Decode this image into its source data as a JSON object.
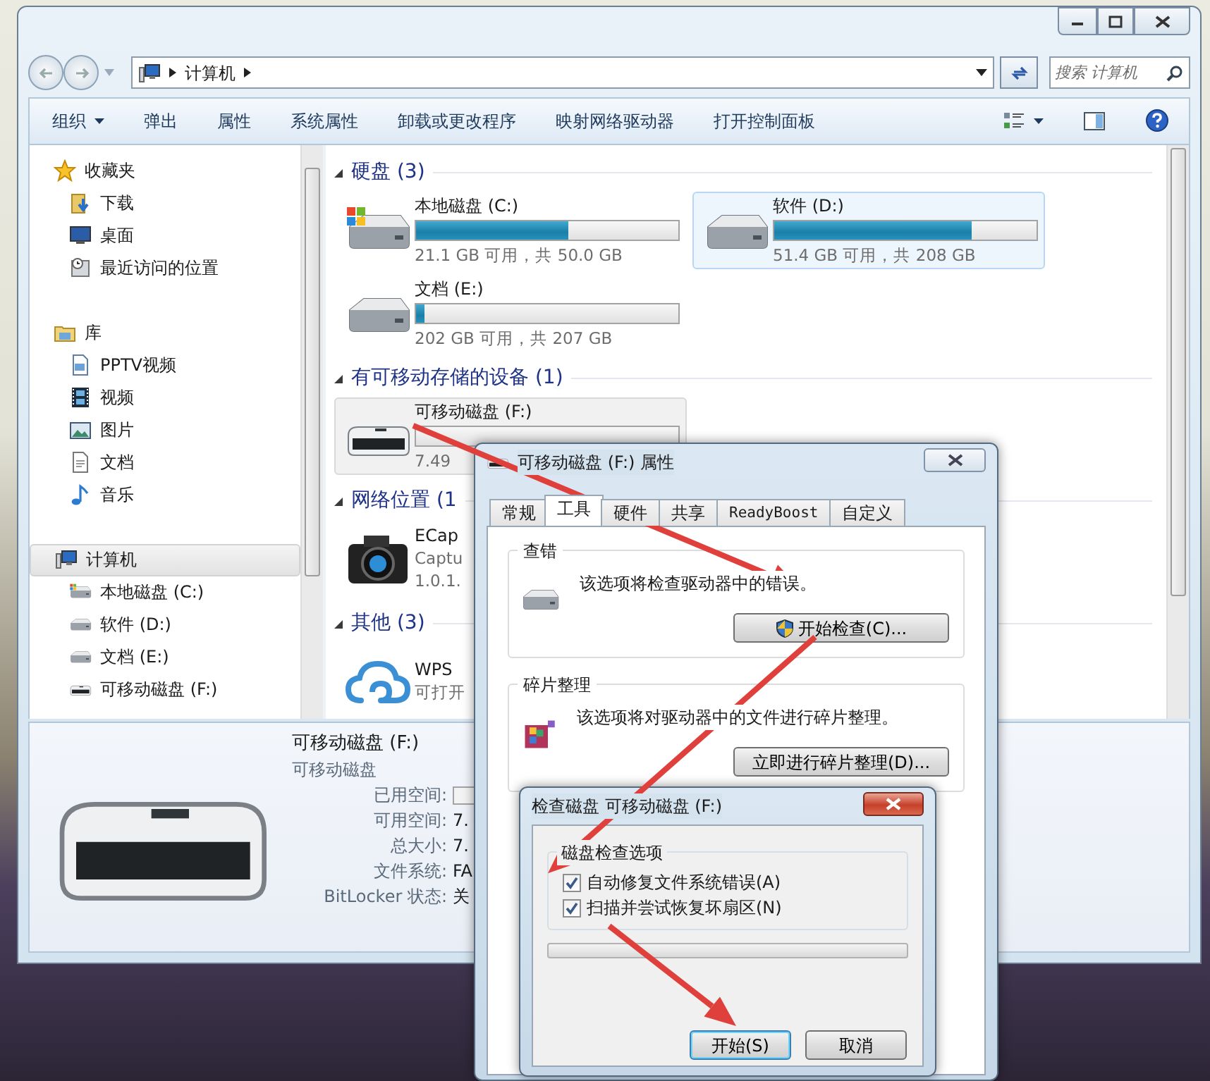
{
  "explorer": {
    "breadcrumb": [
      "计算机"
    ],
    "search_placeholder": "搜索 计算机",
    "toolbar": [
      {
        "label": "组织",
        "kind": "menu"
      },
      {
        "label": "弹出",
        "kind": "command"
      },
      {
        "label": "属性",
        "kind": "command"
      },
      {
        "label": "系统属性",
        "kind": "command"
      },
      {
        "label": "卸载或更改程序",
        "kind": "command"
      },
      {
        "label": "映射网络驱动器",
        "kind": "command"
      },
      {
        "label": "打开控制面板",
        "kind": "command"
      }
    ],
    "nav": [
      {
        "label": "收藏夹",
        "kind": "star",
        "selected": false,
        "children": [
          {
            "label": "下载",
            "kind": "download",
            "selected": false
          },
          {
            "label": "桌面",
            "kind": "desktop",
            "selected": false
          },
          {
            "label": "最近访问的位置",
            "kind": "recent",
            "selected": false
          }
        ]
      },
      {
        "label": "库",
        "kind": "library",
        "selected": false,
        "children": [
          {
            "label": "PPTV视频",
            "kind": "videofile",
            "selected": false
          },
          {
            "label": "视频",
            "kind": "film",
            "selected": false
          },
          {
            "label": "图片",
            "kind": "picture",
            "selected": false
          },
          {
            "label": "文档",
            "kind": "document",
            "selected": false
          },
          {
            "label": "音乐",
            "kind": "music",
            "selected": false
          }
        ]
      },
      {
        "label": "计算机",
        "kind": "computer",
        "selected": true,
        "children": [
          {
            "label": "本地磁盘 (C:)",
            "kind": "system-drive",
            "selected": false
          },
          {
            "label": "软件 (D:)",
            "kind": "drive",
            "selected": false
          },
          {
            "label": "文档 (E:)",
            "kind": "drive",
            "selected": false
          },
          {
            "label": "可移动磁盘 (F:)",
            "kind": "removable-drive",
            "selected": false
          }
        ]
      }
    ],
    "groups": [
      {
        "title": "硬盘 (3)",
        "expanded": true,
        "items": [
          {
            "kind": "system-drive",
            "name": "本地磁盘 (C:)",
            "level": 0.58,
            "reading": "21.1 GB 可用，共 50.0 GB",
            "selected": false,
            "hovered": false
          },
          {
            "kind": "drive",
            "name": "软件 (D:)",
            "level": 0.75,
            "reading": "51.4 GB 可用，共 208 GB",
            "selected": false,
            "hovered": true
          },
          {
            "kind": "drive",
            "name": "文档 (E:)",
            "level": 0.03,
            "reading": "202 GB 可用，共 207 GB",
            "selected": false,
            "hovered": false
          }
        ]
      },
      {
        "title": "有可移动存储的设备 (1)",
        "expanded": true,
        "items": [
          {
            "kind": "removable-drive",
            "name": "可移动磁盘 (F:)",
            "level": 0,
            "reading": "7.49",
            "selected": true,
            "hovered": false
          }
        ]
      },
      {
        "title": "网络位置 (1",
        "expanded": true,
        "items": [
          {
            "kind": "camera-app",
            "lines": [
              "ECap",
              "Captu",
              "1.0.1."
            ],
            "selected": false,
            "hovered": false
          }
        ]
      },
      {
        "title": "其他 (3)",
        "expanded": true,
        "items": [
          {
            "kind": "cloud-app",
            "lines": [
              "WPS",
              "可打开"
            ],
            "selected": false,
            "hovered": false
          }
        ]
      }
    ],
    "details": {
      "title": "可移动磁盘 (F:)",
      "subtitle": "可移动磁盘",
      "fields": [
        {
          "label": "已用空间:",
          "kind": "bar"
        },
        {
          "label": "可用空间:",
          "kind": "text",
          "value": "7."
        },
        {
          "label": "总大小:",
          "kind": "text",
          "value": "7."
        },
        {
          "label": "文件系统:",
          "kind": "text",
          "value": "FA"
        },
        {
          "label": "BitLocker 状态:",
          "kind": "text",
          "value": "关"
        }
      ]
    }
  },
  "properties_dialog": {
    "title": "可移动磁盘 (F:) 属性",
    "tabs": [
      {
        "label": "常规",
        "selected": false
      },
      {
        "label": "工具",
        "selected": true
      },
      {
        "label": "硬件",
        "selected": false
      },
      {
        "label": "共享",
        "selected": false
      },
      {
        "label": "ReadyBoost",
        "selected": false
      },
      {
        "label": "自定义",
        "selected": false
      }
    ],
    "sections": [
      {
        "kind": "check",
        "title": "查错",
        "text": "该选项将检查驱动器中的错误。",
        "button": "开始检查(C)..."
      },
      {
        "kind": "defrag",
        "title": "碎片整理",
        "text": "该选项将对驱动器中的文件进行碎片整理。",
        "button": "立即进行碎片整理(D)..."
      }
    ]
  },
  "check_dialog": {
    "title": "检查磁盘 可移动磁盘 (F:)",
    "group_title": "磁盘检查选项",
    "options": [
      {
        "label": "自动修复文件系统错误(A)",
        "checked": true
      },
      {
        "label": "扫描并尝试恢复坏扇区(N)",
        "checked": true
      }
    ],
    "progress": {
      "level": 0
    },
    "buttons": [
      {
        "label": "开始(S)",
        "default": true
      },
      {
        "label": "取消",
        "default": false
      }
    ]
  }
}
